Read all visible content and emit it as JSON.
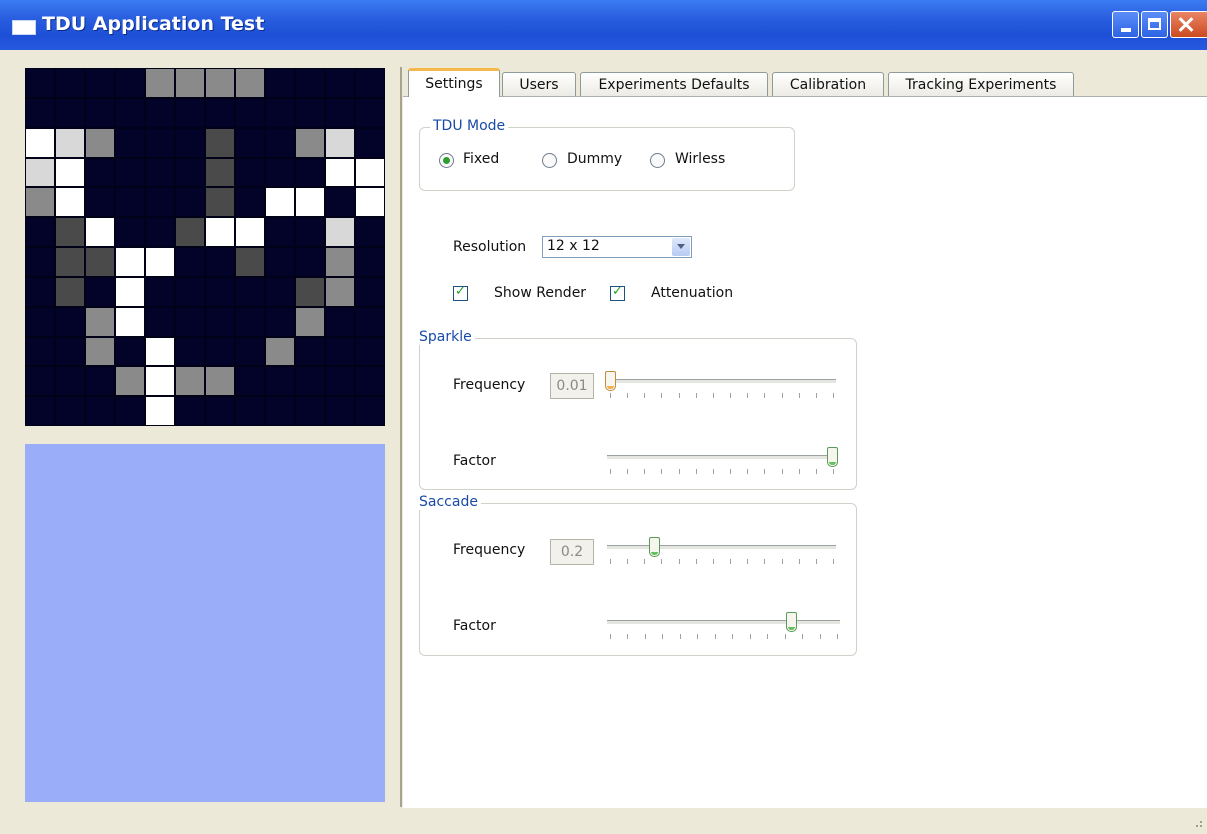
{
  "window": {
    "title": "TDU Application Test"
  },
  "preview": {
    "grid": [
      [
        0,
        0,
        0,
        0,
        2,
        2,
        2,
        2,
        0,
        0,
        0,
        0
      ],
      [
        0,
        0,
        0,
        0,
        0,
        0,
        0,
        0,
        0,
        0,
        0,
        0
      ],
      [
        1,
        3,
        2,
        0,
        0,
        0,
        4,
        0,
        0,
        2,
        3,
        0
      ],
      [
        3,
        1,
        0,
        0,
        0,
        0,
        4,
        0,
        0,
        0,
        1,
        1
      ],
      [
        2,
        1,
        0,
        0,
        0,
        0,
        4,
        0,
        1,
        1,
        0,
        1
      ],
      [
        0,
        4,
        1,
        0,
        0,
        4,
        1,
        1,
        0,
        0,
        3,
        0
      ],
      [
        0,
        4,
        4,
        1,
        1,
        0,
        0,
        4,
        0,
        0,
        2,
        0
      ],
      [
        0,
        4,
        0,
        1,
        0,
        0,
        0,
        0,
        0,
        4,
        2,
        0
      ],
      [
        0,
        0,
        2,
        1,
        0,
        0,
        0,
        0,
        0,
        2,
        0,
        0
      ],
      [
        0,
        0,
        2,
        0,
        1,
        0,
        0,
        0,
        2,
        0,
        0,
        0
      ],
      [
        0,
        0,
        0,
        2,
        1,
        2,
        2,
        0,
        0,
        0,
        0,
        0
      ],
      [
        0,
        0,
        0,
        0,
        1,
        0,
        0,
        0,
        0,
        0,
        0,
        0
      ]
    ],
    "palette": [
      "#03032a",
      "#ffffff",
      "#8a8a8a",
      "#d8d8d8",
      "#4a4a4a"
    ]
  },
  "tabs": [
    {
      "label": "Settings",
      "active": true
    },
    {
      "label": "Users"
    },
    {
      "label": "Experiments Defaults"
    },
    {
      "label": "Calibration"
    },
    {
      "label": "Tracking Experiments"
    }
  ],
  "settings": {
    "tdu_mode": {
      "legend": "TDU Mode",
      "options": [
        {
          "label": "Fixed",
          "checked": true
        },
        {
          "label": "Dummy",
          "checked": false
        },
        {
          "label": "Wirless",
          "checked": false
        }
      ]
    },
    "resolution": {
      "label": "Resolution",
      "value": "12 x 12"
    },
    "show_render": {
      "label": "Show Render",
      "checked": true
    },
    "attenuation": {
      "label": "Attenuation",
      "checked": true
    },
    "sparkle": {
      "legend": "Sparkle",
      "frequency": {
        "label": "Frequency",
        "value": "0.01",
        "level": 0.0
      },
      "factor": {
        "label": "Factor",
        "level": 1.0
      }
    },
    "saccade": {
      "legend": "Saccade",
      "frequency": {
        "label": "Frequency",
        "value": "0.2",
        "level": 0.2
      },
      "factor": {
        "label": "Factor",
        "level": 0.8
      }
    }
  }
}
